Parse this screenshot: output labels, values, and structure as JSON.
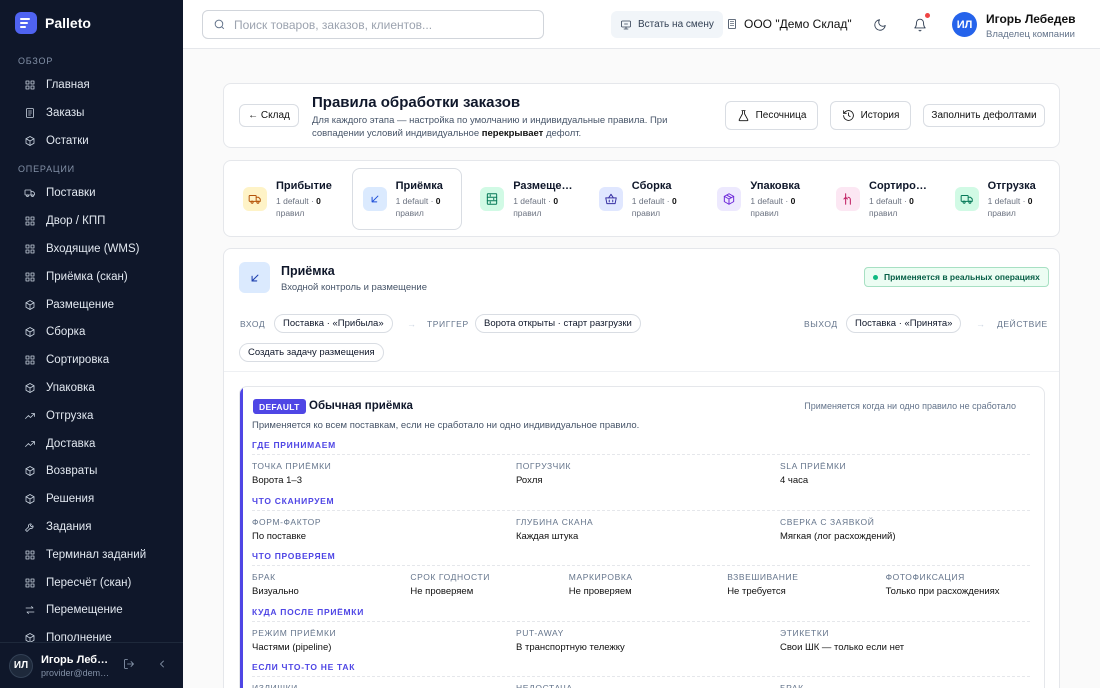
{
  "app": {
    "name": "Palleto"
  },
  "sidebar": {
    "sections": [
      {
        "title": "ОБЗОР",
        "items": [
          {
            "label": "Главная",
            "icon": "grid-icon"
          },
          {
            "label": "Заказы",
            "icon": "list-icon"
          },
          {
            "label": "Остатки",
            "icon": "box-icon"
          }
        ]
      },
      {
        "title": "ОПЕРАЦИИ",
        "items": [
          {
            "label": "Поставки",
            "icon": "truck-icon"
          },
          {
            "label": "Двор / КПП",
            "icon": "grid-icon"
          },
          {
            "label": "Входящие (WMS)",
            "icon": "grid-icon"
          },
          {
            "label": "Приёмка (скан)",
            "icon": "grid-icon"
          },
          {
            "label": "Размещение",
            "icon": "box-icon"
          },
          {
            "label": "Сборка",
            "icon": "box-icon"
          },
          {
            "label": "Сортировка",
            "icon": "grid-icon"
          },
          {
            "label": "Упаковка",
            "icon": "box-icon"
          },
          {
            "label": "Отгрузка",
            "icon": "trend-icon"
          },
          {
            "label": "Доставка",
            "icon": "trend-icon"
          },
          {
            "label": "Возвраты",
            "icon": "box-icon"
          },
          {
            "label": "Решения",
            "icon": "box-icon"
          },
          {
            "label": "Задания",
            "icon": "wrench-icon"
          },
          {
            "label": "Терминал заданий",
            "icon": "grid-icon"
          },
          {
            "label": "Пересчёт (скан)",
            "icon": "grid-icon"
          },
          {
            "label": "Перемещение",
            "icon": "swap-icon"
          },
          {
            "label": "Пополнение",
            "icon": "box-icon"
          }
        ]
      }
    ],
    "user": {
      "initials": "ИЛ",
      "name": "Игорь Лебедев",
      "email": "provider@demo.palleto"
    }
  },
  "topbar": {
    "search_placeholder": "Поиск товаров, заказов, клиентов...",
    "shift_label": "Встать на смену",
    "org": "ООО \"Демо Склад\"",
    "user": {
      "initials": "ИЛ",
      "name": "Игорь Лебедев",
      "role": "Владелец компании"
    }
  },
  "header": {
    "back_label": "← Склад",
    "title": "Правила обработки заказов",
    "desc_1": "Для каждого этапа — настройка по умолчанию и индивидуальные правила. При совпадении условий индивидуальное ",
    "desc_bold": "перекрывает",
    "desc_2": " дефолт.",
    "sandbox_label": "Песочница",
    "history_label": "История",
    "defaults_label": "Заполнить дефолтами"
  },
  "stages": [
    {
      "name": "Прибытие",
      "default": "1 default · ",
      "count": "0",
      "unit": "правил",
      "icon": "truck-icon",
      "bg": "#fef3c7",
      "fg": "#b45309"
    },
    {
      "name": "Приёмка",
      "default": "1 default · ",
      "count": "0",
      "unit": "правил",
      "icon": "arrow-in-icon",
      "bg": "#dbeafe",
      "fg": "#1d4ed8"
    },
    {
      "name": "Размещение",
      "default": "1 default · ",
      "count": "0",
      "unit": "правил",
      "icon": "shelf-icon",
      "bg": "#d1fae5",
      "fg": "#047857"
    },
    {
      "name": "Сборка",
      "default": "1 default · ",
      "count": "0",
      "unit": "правил",
      "icon": "basket-icon",
      "bg": "#e0e7ff",
      "fg": "#3730a3"
    },
    {
      "name": "Упаковка",
      "default": "1 default · ",
      "count": "0",
      "unit": "правил",
      "icon": "package-icon",
      "bg": "#ede9fe",
      "fg": "#6d28d9"
    },
    {
      "name": "Сортировка",
      "default": "1 default · ",
      "count": "0",
      "unit": "правил",
      "icon": "split-icon",
      "bg": "#fce7f3",
      "fg": "#be185d"
    },
    {
      "name": "Отгрузка",
      "default": "1 default · ",
      "count": "0",
      "unit": "правил",
      "icon": "truck-icon",
      "bg": "#d1fae5",
      "fg": "#047857"
    }
  ],
  "section": {
    "title": "Приёмка",
    "subtitle": "Входной контроль и размещение",
    "live_badge": "Применяется в реальных операциях",
    "flow": {
      "in_label": "ВХОД",
      "in_value": "Поставка · «Прибыла»",
      "trigger_label": "ТРИГГЕР",
      "trigger_value": "Ворота открыты · старт разгрузки",
      "out_label": "ВЫХОД",
      "out_value": "Поставка · «Принята»",
      "action_label": "ДЕЙСТВИЕ",
      "action_value": "Создать задачу размещения",
      "arrow": "→"
    }
  },
  "rule": {
    "badge": "DEFAULT",
    "title": "Обычная приёмка",
    "when": "Применяется когда ни одно правило не сработало",
    "desc": "Применяется ко всем поставкам, если не сработало ни одно индивидуальное правило.",
    "groups": [
      {
        "title": "ГДЕ ПРИНИМАЕМ",
        "fields": [
          {
            "label": "ТОЧКА ПРИЁМКИ",
            "value": "Ворота 1–3"
          },
          {
            "label": "ПОГРУЗЧИК",
            "value": "Рохля"
          },
          {
            "label": "SLA ПРИЁМКИ",
            "value": "4 часа"
          }
        ]
      },
      {
        "title": "ЧТО СКАНИРУЕМ",
        "fields": [
          {
            "label": "ФОРМ-ФАКТОР",
            "value": "По поставке"
          },
          {
            "label": "ГЛУБИНА СКАНА",
            "value": "Каждая штука"
          },
          {
            "label": "СВЕРКА С ЗАЯВКОЙ",
            "value": "Мягкая (лог расхождений)"
          }
        ]
      },
      {
        "title": "ЧТО ПРОВЕРЯЕМ",
        "fields": [
          {
            "label": "БРАК",
            "value": "Визуально"
          },
          {
            "label": "СРОК ГОДНОСТИ",
            "value": "Не проверяем"
          },
          {
            "label": "МАРКИРОВКА",
            "value": "Не проверяем"
          },
          {
            "label": "ВЗВЕШИВАНИЕ",
            "value": "Не требуется"
          },
          {
            "label": "ФОТОФИКСАЦИЯ",
            "value": "Только при расхождениях"
          }
        ]
      },
      {
        "title": "КУДА ПОСЛЕ ПРИЁМКИ",
        "fields": [
          {
            "label": "РЕЖИМ ПРИЁМКИ",
            "value": "Частями (pipeline)"
          },
          {
            "label": "PUT-AWAY",
            "value": "В транспортную тележку"
          },
          {
            "label": "ЭТИКЕТКИ",
            "value": "Свои ШК — только если нет"
          }
        ]
      },
      {
        "title": "ЕСЛИ ЧТО-ТО НЕ ТАК",
        "fields": [
          {
            "label": "ИЗЛИШКИ",
            "value": ""
          },
          {
            "label": "НЕДОСТАЧА",
            "value": ""
          },
          {
            "label": "БРАК",
            "value": ""
          }
        ]
      }
    ]
  }
}
